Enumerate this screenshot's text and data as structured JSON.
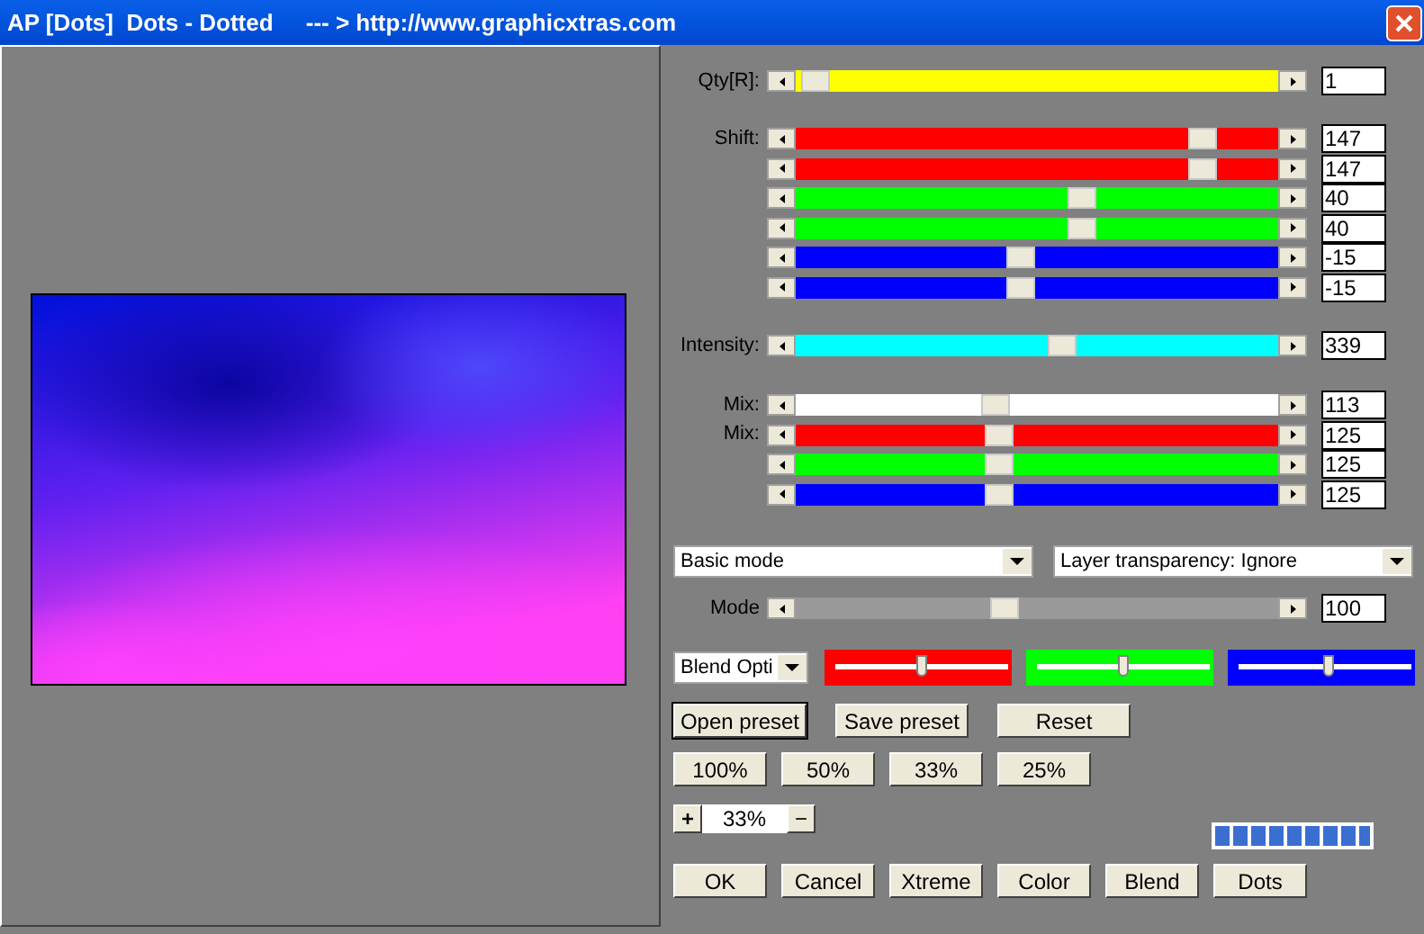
{
  "window": {
    "title": "AP [Dots]  Dots - Dotted     --- > http://www.graphicxtras.com"
  },
  "preview": {
    "kind": "picture"
  },
  "slider_groups": [
    {
      "rows": [
        {
          "label": "Qty[R]:",
          "color": "#ffff00",
          "level": 0.01,
          "value": "1"
        }
      ]
    },
    {
      "rows": [
        {
          "label": "Shift:",
          "color": "#ff0000",
          "level": 0.865,
          "value": "147"
        },
        {
          "color": "#ff0000",
          "level": 0.865,
          "value": "147"
        },
        {
          "color": "#00ff00",
          "level": 0.6,
          "value": "40"
        },
        {
          "color": "#00ff00",
          "level": 0.6,
          "value": "40"
        },
        {
          "color": "#0000ff",
          "level": 0.464,
          "value": "-15"
        },
        {
          "color": "#0000ff",
          "level": 0.464,
          "value": "-15"
        }
      ]
    },
    {
      "rows": [
        {
          "label": "Intensity:",
          "color": "#00ffff",
          "level": 0.556,
          "value": "339"
        }
      ]
    },
    {
      "rows": [
        {
          "label": "Mix:",
          "color": "#ffffff",
          "level": 0.41,
          "value": "113"
        },
        {
          "label": "Mix:",
          "color": "#ff0000",
          "level": 0.417,
          "value": "125"
        },
        {
          "color": "#00ff00",
          "level": 0.417,
          "value": "125"
        },
        {
          "color": "#0000ff",
          "level": 0.417,
          "value": "125"
        }
      ]
    }
  ],
  "dropdowns": [
    "Basic mode",
    "Layer transparency: Ignore"
  ],
  "mode_slider": {
    "label": "Mode",
    "color": "#999999",
    "level": 0.43,
    "value": "100"
  },
  "blend_dropdown": "Blend Opti",
  "blend_sliders": [
    {
      "color": "#ff0000",
      "level": 0.5
    },
    {
      "color": "#00ff00",
      "level": 0.5
    },
    {
      "color": "#0000ff",
      "level": 0.52
    }
  ],
  "preset_buttons": [
    {
      "label": "Open preset",
      "focused": true
    },
    {
      "label": "Save preset",
      "focused": false
    },
    {
      "label": "Reset",
      "focused": false
    }
  ],
  "zoom_buttons": [
    "100%",
    "50%",
    "33%",
    "25%"
  ],
  "zoom": {
    "plus": "+",
    "value": "33%",
    "minus": "−"
  },
  "progress": {
    "level": 1
  },
  "buttons": [
    "OK",
    "Cancel",
    "Xtreme",
    "Color",
    "Blend",
    "Dots"
  ]
}
